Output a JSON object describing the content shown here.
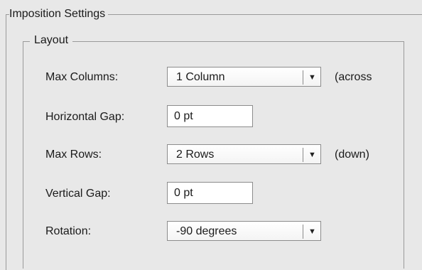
{
  "imposition": {
    "title": "Imposition Settings",
    "layout": {
      "title": "Layout",
      "max_columns": {
        "label": "Max Columns:",
        "value": "1 Column",
        "suffix": "(across"
      },
      "horizontal_gap": {
        "label": "Horizontal Gap:",
        "value": "0 pt"
      },
      "max_rows": {
        "label": "Max Rows:",
        "value": "2 Rows",
        "suffix": "(down)"
      },
      "vertical_gap": {
        "label": "Vertical Gap:",
        "value": "0 pt"
      },
      "rotation": {
        "label": "Rotation:",
        "value": "-90 degrees"
      }
    }
  },
  "icons": {
    "dropdown_arrow": "▼"
  }
}
